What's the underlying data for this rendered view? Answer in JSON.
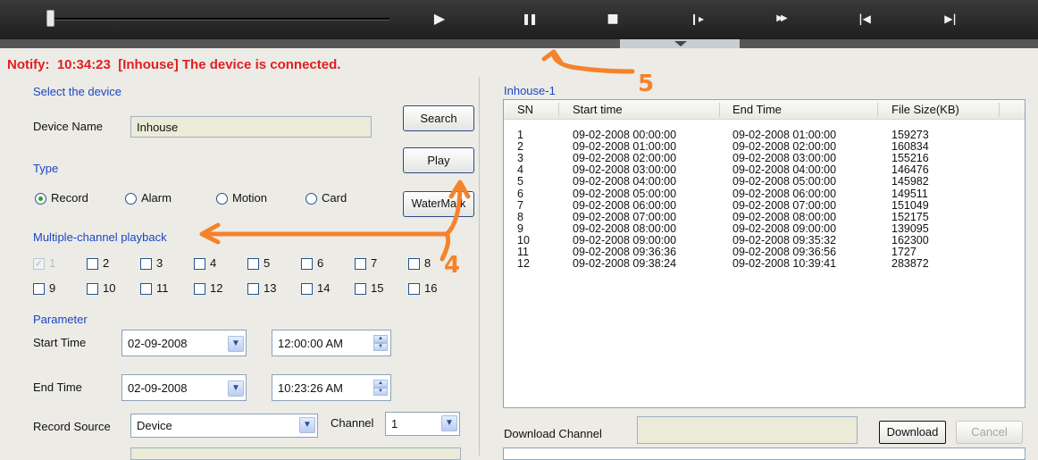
{
  "player": {
    "progress": 0.0,
    "buttons": [
      {
        "name": "play-icon",
        "glyph": "▶"
      },
      {
        "name": "pause-icon",
        "glyph": "❚❚"
      },
      {
        "name": "stop-icon",
        "glyph": "■"
      },
      {
        "name": "step-forward-icon",
        "glyph": "❙▸"
      },
      {
        "name": "fast-forward-icon",
        "glyph": "▶▶"
      },
      {
        "name": "skip-back-icon",
        "glyph": "|◀"
      },
      {
        "name": "skip-next-icon",
        "glyph": "▶|"
      }
    ]
  },
  "notify": "Notify:  10:34:23  [Inhouse] The device is connected.",
  "device": {
    "section": "Select the device",
    "name_label": "Device Name",
    "name_value": "Inhouse"
  },
  "buttons": {
    "search": "Search",
    "play": "Play",
    "watermark": "WaterMark",
    "download": "Download",
    "cancel": "Cancel"
  },
  "type": {
    "label": "Type",
    "options": [
      "Record",
      "Alarm",
      "Motion",
      "Card"
    ],
    "selected": "Record"
  },
  "multichannel": {
    "label": "Multiple-channel playback",
    "channels": [
      "1",
      "2",
      "3",
      "4",
      "5",
      "6",
      "7",
      "8",
      "9",
      "10",
      "11",
      "12",
      "13",
      "14",
      "15",
      "16"
    ]
  },
  "parameter": {
    "label": "Parameter",
    "start_label": "Start Time",
    "start_date": "02-09-2008",
    "start_time": "12:00:00 AM",
    "end_label": "End Time",
    "end_date": "02-09-2008",
    "end_time": "10:23:26 AM",
    "source_label": "Record Source",
    "source_value": "Device",
    "channel_label": "Channel",
    "channel_value": "1"
  },
  "list": {
    "title": "Inhouse-1",
    "columns": [
      "SN",
      "Start time",
      "End Time",
      "File Size(KB)"
    ],
    "rows": [
      [
        "1",
        "09-02-2008 00:00:00",
        "09-02-2008 01:00:00",
        "159273"
      ],
      [
        "2",
        "09-02-2008 01:00:00",
        "09-02-2008 02:00:00",
        "160834"
      ],
      [
        "3",
        "09-02-2008 02:00:00",
        "09-02-2008 03:00:00",
        "155216"
      ],
      [
        "4",
        "09-02-2008 03:00:00",
        "09-02-2008 04:00:00",
        "146476"
      ],
      [
        "5",
        "09-02-2008 04:00:00",
        "09-02-2008 05:00:00",
        "145982"
      ],
      [
        "6",
        "09-02-2008 05:00:00",
        "09-02-2008 06:00:00",
        "149511"
      ],
      [
        "7",
        "09-02-2008 06:00:00",
        "09-02-2008 07:00:00",
        "151049"
      ],
      [
        "8",
        "09-02-2008 07:00:00",
        "09-02-2008 08:00:00",
        "152175"
      ],
      [
        "9",
        "09-02-2008 08:00:00",
        "09-02-2008 09:00:00",
        "139095"
      ],
      [
        "10",
        "09-02-2008 09:00:00",
        "09-02-2008 09:35:32",
        "162300"
      ],
      [
        "11",
        "09-02-2008 09:36:36",
        "09-02-2008 09:36:56",
        "1727"
      ],
      [
        "12",
        "09-02-2008 09:38:24",
        "09-02-2008 10:39:41",
        "283872"
      ]
    ]
  },
  "download_channel": {
    "label": "Download Channel",
    "value": ""
  },
  "annotations": {
    "five": "5",
    "four": "4",
    "color": "#f4832c"
  },
  "colors": {
    "notify": "#e02020",
    "section_blue": "#1b46c4",
    "player_bg": "#2c2c2c"
  }
}
